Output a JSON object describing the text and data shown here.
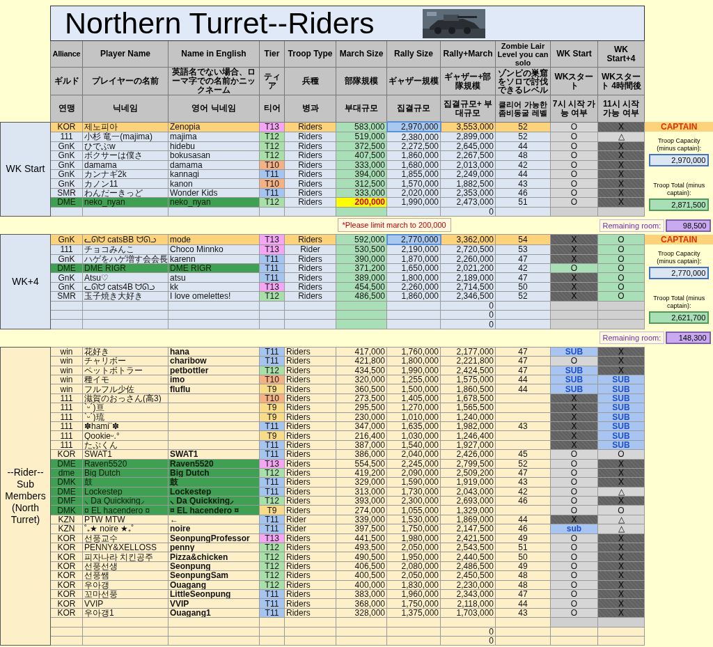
{
  "title": "Northern Turret--Riders",
  "header_rows": [
    [
      "Alliance",
      "Player Name",
      "Name in English",
      "Tier",
      "Troop Type",
      "March Size",
      "Rally Size",
      "Rally+March",
      "Zombie Lair Level you can solo",
      "WK Start",
      "WK Start+4"
    ],
    [
      "ギルド",
      "プレイヤーの名前",
      "英語名でない場合、ローマ字での名前かニックネーム",
      "ティア",
      "兵種",
      "部隊規模",
      "ギャザー規模",
      "ギャザー+部隊規模",
      "ゾンビの巣窟をソロで討伐できるレベル",
      "WKスタート",
      "WKスタート 4時間後"
    ],
    [
      "연맹",
      "닉네임",
      "영어 닉네임",
      "티어",
      "병과",
      "부대규모",
      "집결규모",
      "집결규모+ 부대규모",
      "클리어 가능한 좀비동굴 레벨",
      "7시 시작 가능 여부",
      "11시 시작 가능 여부"
    ]
  ],
  "sections": [
    {
      "label": "WK Start",
      "kind": "wave",
      "note": "*Please limit march to 200,000",
      "side": {
        "badge": "CAPTAIN",
        "capacity_label": "Troop Capacity (minus captain):",
        "capacity": "2,970,000",
        "total_label": "Troop Total (minus captain):",
        "total": "2,871,500",
        "remaining_label": "Remaining room:",
        "remaining": "98,500"
      },
      "rows": [
        {
          "kind": "captain",
          "alliance": "KOR",
          "player": "제노피아",
          "english": "Zenopia",
          "tier": {
            "text": "T13",
            "color": "#f4a6f4"
          },
          "troop": "Riders",
          "march": "583,000",
          "over_limit": false,
          "rally": "2,970,000",
          "total": "3,553,000",
          "lair": "52",
          "wk": {
            "text": "O",
            "kind": "yes"
          },
          "wk4": {
            "text": "X",
            "kind": "no"
          }
        },
        {
          "kind": "normal",
          "alliance": "111",
          "player": "小杉 竜一(majima)",
          "english": "majima",
          "tier": {
            "text": "T12",
            "color": "#a9dfa9"
          },
          "troop": "Riders",
          "march": "519,000",
          "over_limit": false,
          "rally": "2,380,000",
          "total": "2,899,000",
          "lair": "52",
          "wk": {
            "text": "O",
            "kind": "yes"
          },
          "wk4": {
            "text": "△",
            "kind": "maybe"
          }
        },
        {
          "kind": "normal",
          "alliance": "GnK",
          "player": "ひでぶw",
          "english": "hidebu",
          "tier": {
            "text": "T12",
            "color": "#a9dfa9"
          },
          "troop": "Riders",
          "march": "372,500",
          "over_limit": false,
          "rally": "2,272,500",
          "total": "2,645,000",
          "lair": "44",
          "wk": {
            "text": "O",
            "kind": "yes"
          },
          "wk4": {
            "text": "X",
            "kind": "no"
          }
        },
        {
          "kind": "normal",
          "alliance": "GnK",
          "player": "ボクサーは僕さ",
          "english": "bokusasan",
          "tier": {
            "text": "T12",
            "color": "#a9dfa9"
          },
          "troop": "Riders",
          "march": "407,500",
          "over_limit": false,
          "rally": "1,860,000",
          "total": "2,267,500",
          "lair": "48",
          "wk": {
            "text": "O",
            "kind": "yes"
          },
          "wk4": {
            "text": "X",
            "kind": "no"
          }
        },
        {
          "kind": "normal",
          "alliance": "GnK",
          "player": "damama",
          "english": "damama",
          "tier": {
            "text": "T10",
            "color": "#f4b183"
          },
          "troop": "Riders",
          "march": "333,000",
          "over_limit": false,
          "rally": "1,680,000",
          "total": "2,013,000",
          "lair": "42",
          "wk": {
            "text": "O",
            "kind": "yes"
          },
          "wk4": {
            "text": "X",
            "kind": "no"
          }
        },
        {
          "kind": "normal",
          "alliance": "GnK",
          "player": "カンナギ2k",
          "english": "kannagi",
          "tier": {
            "text": "T11",
            "color": "#a6c4f0"
          },
          "troop": "Riders",
          "march": "394,000",
          "over_limit": false,
          "rally": "1,855,000",
          "total": "2,249,000",
          "lair": "44",
          "wk": {
            "text": "O",
            "kind": "yes"
          },
          "wk4": {
            "text": "X",
            "kind": "no"
          }
        },
        {
          "kind": "normal",
          "alliance": "GnK",
          "player": "カノン11",
          "english": "kanon",
          "tier": {
            "text": "T10",
            "color": "#f4b183"
          },
          "troop": "Riders",
          "march": "312,500",
          "over_limit": false,
          "rally": "1,570,000",
          "total": "1,882,500",
          "lair": "43",
          "wk": {
            "text": "O",
            "kind": "yes"
          },
          "wk4": {
            "text": "X",
            "kind": "no"
          }
        },
        {
          "kind": "normal",
          "alliance": "SMR",
          "player": "わんだーきっど",
          "english": "Wonder Kids",
          "tier": {
            "text": "T11",
            "color": "#a6c4f0"
          },
          "troop": "Riders",
          "march": "333,000",
          "over_limit": false,
          "rally": "2,020,000",
          "total": "2,353,000",
          "lair": "46",
          "wk": {
            "text": "O",
            "kind": "yes"
          },
          "wk4": {
            "text": "X",
            "kind": "no"
          }
        },
        {
          "kind": "ally",
          "alliance": "DME",
          "player": "neko_nyan",
          "english": "neko_nyan",
          "tier": {
            "text": "T12",
            "color": "#a9dfa9"
          },
          "troop": "Riders",
          "march": "200,000",
          "over_limit": true,
          "rally": "1,990,000",
          "total": "2,473,000",
          "lair": "51",
          "wk": {
            "text": "O",
            "kind": "yes"
          },
          "wk4": {
            "text": "X",
            "kind": "no"
          }
        },
        {
          "kind": "normal",
          "total": "0",
          "over_limit": false,
          "wk": {
            "kind": "blank"
          },
          "wk4": {
            "kind": "blank"
          }
        }
      ]
    },
    {
      "label": "WK+4",
      "kind": "wave",
      "side": {
        "badge": "CAPTAIN",
        "capacity_label": "Troop Capacity (minus captain):",
        "capacity": "2,770,000",
        "total_label": "Troop Total (minus captain):",
        "total": "2,621,700",
        "remaining_label": "Remaining room:",
        "remaining": "148,300"
      },
      "rows": [
        {
          "kind": "captain",
          "alliance": "GnK",
          "player": "ᓚᘏᗢ catsBB ᗢᘏᓗ",
          "english": "mode",
          "tier": {
            "text": "T13",
            "color": "#f4a6f4"
          },
          "troop": "Riders",
          "march": "592,000",
          "over_limit": false,
          "rally": "2,770,000",
          "total": "3,362,000",
          "lair": "54",
          "wk": {
            "text": "X",
            "kind": "no"
          },
          "wk4": {
            "text": "O",
            "kind": "go"
          }
        },
        {
          "kind": "normal",
          "alliance": "111",
          "player": "チョコみんこ",
          "english": "Choco Minnko",
          "tier": {
            "text": "T13",
            "color": "#f4a6f4"
          },
          "troop": "Rider",
          "march": "530,500",
          "over_limit": false,
          "rally": "2,190,000",
          "total": "2,720,500",
          "lair": "53",
          "wk": {
            "text": "X",
            "kind": "no"
          },
          "wk4": {
            "text": "O",
            "kind": "go"
          }
        },
        {
          "kind": "normal",
          "alliance": "GnK",
          "player": "ハゲをハゲ増す会会長",
          "english": "karenn",
          "tier": {
            "text": "T11",
            "color": "#a6c4f0"
          },
          "troop": "Riders",
          "march": "390,000",
          "over_limit": false,
          "rally": "1,870,000",
          "total": "2,260,000",
          "lair": "47",
          "wk": {
            "text": "X",
            "kind": "no"
          },
          "wk4": {
            "text": "O",
            "kind": "go"
          }
        },
        {
          "kind": "ally",
          "alliance": "DME",
          "player": "DME RIGR",
          "english": "DME RIGR",
          "tier": {
            "text": "T11",
            "color": "#a6c4f0"
          },
          "troop": "Riders",
          "march": "371,200",
          "over_limit": false,
          "rally": "1,650,000",
          "total": "2,021,200",
          "lair": "42",
          "wk": {
            "text": "O",
            "kind": "go"
          },
          "wk4": {
            "text": "O",
            "kind": "go"
          }
        },
        {
          "kind": "normal",
          "alliance": "GnK",
          "player": "Atsu♡",
          "english": "atsu",
          "tier": {
            "text": "T11",
            "color": "#a6c4f0"
          },
          "troop": "Riders",
          "march": "389,000",
          "over_limit": false,
          "rally": "1,800,000",
          "total": "2,189,000",
          "lair": "47",
          "wk": {
            "text": "X",
            "kind": "no"
          },
          "wk4": {
            "text": "O",
            "kind": "go"
          }
        },
        {
          "kind": "normal",
          "alliance": "GnK",
          "player": "ᓚᘏᗢ cats4B ᗢᘏᓗ",
          "english": "kk",
          "tier": {
            "text": "T13",
            "color": "#f4a6f4"
          },
          "troop": "Riders",
          "march": "454,500",
          "over_limit": false,
          "rally": "2,260,000",
          "total": "2,714,500",
          "lair": "50",
          "wk": {
            "text": "X",
            "kind": "no"
          },
          "wk4": {
            "text": "O",
            "kind": "go"
          }
        },
        {
          "kind": "normal",
          "alliance": "SMR",
          "player": "玉子焼き大好き",
          "english": "I love omelettes!",
          "tier": {
            "text": "T12",
            "color": "#a9dfa9"
          },
          "troop": "Riders",
          "march": "486,500",
          "over_limit": false,
          "rally": "1,860,000",
          "total": "2,346,500",
          "lair": "52",
          "wk": {
            "text": "X",
            "kind": "no"
          },
          "wk4": {
            "text": "O",
            "kind": "go"
          }
        },
        {
          "kind": "normal",
          "total": "0",
          "over_limit": false,
          "wk": {
            "kind": "blank"
          },
          "wk4": {
            "kind": "blank"
          }
        },
        {
          "kind": "normal",
          "total": "0",
          "over_limit": false,
          "wk": {
            "kind": "blank"
          },
          "wk4": {
            "kind": "blank"
          }
        },
        {
          "kind": "normal",
          "total": "0",
          "over_limit": false,
          "wk": {
            "kind": "blank"
          },
          "wk4": {
            "kind": "blank"
          }
        }
      ]
    },
    {
      "label": "--Rider-- Sub Members (North Turret)",
      "kind": "reserve",
      "rows": [
        {
          "kind": "normal",
          "alliance": "win",
          "player": "花好き",
          "english": "hana",
          "tier": {
            "text": "T11",
            "color": "#a6c4f0"
          },
          "troop": "Riders",
          "march": "417,000",
          "over_limit": false,
          "rally": "1,760,000",
          "total": "2,177,000",
          "lair": "47",
          "wk": {
            "text": "SUB",
            "kind": "sub"
          },
          "wk4": {
            "text": "X",
            "kind": "no"
          }
        },
        {
          "kind": "normal",
          "alliance": "win",
          "player": "チャリボー",
          "english": "charibow",
          "tier": {
            "text": "T11",
            "color": "#a6c4f0"
          },
          "troop": "Riders",
          "march": "421,800",
          "over_limit": false,
          "rally": "1,800,000",
          "total": "2,221,800",
          "lair": "47",
          "wk": {
            "text": "O",
            "kind": "yes"
          },
          "wk4": {
            "text": "X",
            "kind": "no"
          }
        },
        {
          "kind": "normal",
          "alliance": "win",
          "player": "ペットボトラー",
          "english": "petbottler",
          "tier": {
            "text": "T12",
            "color": "#a9dfa9"
          },
          "troop": "Riders",
          "march": "434,500",
          "over_limit": false,
          "rally": "1,990,000",
          "total": "2,424,500",
          "lair": "47",
          "wk": {
            "text": "SUB",
            "kind": "sub"
          },
          "wk4": {
            "text": "X",
            "kind": "no"
          }
        },
        {
          "kind": "normal",
          "alliance": "win",
          "player": "種イモ",
          "english": "imo",
          "tier": {
            "text": "T10",
            "color": "#f4b183"
          },
          "troop": "Riders",
          "march": "320,000",
          "over_limit": false,
          "rally": "1,255,000",
          "total": "1,575,000",
          "lair": "44",
          "wk": {
            "text": "SUB",
            "kind": "sub"
          },
          "wk4": {
            "text": "SUB",
            "kind": "sub"
          }
        },
        {
          "kind": "normal",
          "alliance": "win",
          "player": "フルフル少佐",
          "english": "fluflu",
          "tier": {
            "text": "T9",
            "color": "#f9dc8a"
          },
          "troop": "Riders",
          "march": "360,500",
          "over_limit": false,
          "rally": "1,500,000",
          "total": "1,860,500",
          "lair": "44",
          "wk": {
            "text": "SUB",
            "kind": "sub"
          },
          "wk4": {
            "text": "SUB",
            "kind": "sub"
          }
        },
        {
          "kind": "normal",
          "alliance": "111",
          "player": "滋賀のおっさん(高3)",
          "tier": {
            "text": "T10",
            "color": "#f4b183"
          },
          "troop": "Riders",
          "march": "273,500",
          "over_limit": false,
          "rally": "1,405,000",
          "total": "1,678,500",
          "wk": {
            "text": "X",
            "kind": "no"
          },
          "wk4": {
            "text": "SUB",
            "kind": "sub"
          }
        },
        {
          "kind": "normal",
          "alliance": "111",
          "player": "`ᵕ´)亘",
          "tier": {
            "text": "T9",
            "color": "#f9dc8a"
          },
          "troop": "Riders",
          "march": "295,500",
          "over_limit": false,
          "rally": "1,270,000",
          "total": "1,565,500",
          "wk": {
            "text": "X",
            "kind": "no"
          },
          "wk4": {
            "text": "SUB",
            "kind": "sub"
          }
        },
        {
          "kind": "normal",
          "alliance": "111",
          "player": "`ᵕ´)琉",
          "tier": {
            "text": "T9",
            "color": "#f9dc8a"
          },
          "troop": "Riders",
          "march": "230,000",
          "over_limit": false,
          "rally": "1,010,000",
          "total": "1,240,000",
          "wk": {
            "text": "X",
            "kind": "no"
          },
          "wk4": {
            "text": "SUB",
            "kind": "sub"
          }
        },
        {
          "kind": "normal",
          "alliance": "111",
          "player": "✽hami¨✽",
          "tier": {
            "text": "T11",
            "color": "#a6c4f0"
          },
          "troop": "Riders",
          "march": "347,000",
          "over_limit": false,
          "rally": "1,635,000",
          "total": "1,982,000",
          "lair": "43",
          "wk": {
            "text": "X",
            "kind": "no"
          },
          "wk4": {
            "text": "SUB",
            "kind": "sub"
          }
        },
        {
          "kind": "normal",
          "alliance": "111",
          "player": "Qookieᵕ.°",
          "tier": {
            "text": "T9",
            "color": "#f9dc8a"
          },
          "troop": "Riders",
          "march": "216,400",
          "over_limit": false,
          "rally": "1,030,000",
          "total": "1,246,400",
          "wk": {
            "text": "X",
            "kind": "no"
          },
          "wk4": {
            "text": "SUB",
            "kind": "sub"
          }
        },
        {
          "kind": "normal",
          "alliance": "111",
          "player": "たぷくん",
          "tier": {
            "text": "T11",
            "color": "#a6c4f0"
          },
          "troop": "Riders",
          "march": "387,000",
          "over_limit": false,
          "rally": "1,540,000",
          "total": "1,927,000",
          "wk": {
            "text": "X",
            "kind": "no"
          },
          "wk4": {
            "text": "SUB",
            "kind": "sub"
          }
        },
        {
          "kind": "normal",
          "alliance": "KOR",
          "player": "SWAT1",
          "english": "SWAT1",
          "tier": {
            "text": "T11",
            "color": "#a6c4f0"
          },
          "troop": "Riders",
          "march": "386,000",
          "over_limit": false,
          "rally": "2,040,000",
          "total": "2,426,000",
          "lair": "45",
          "wk": {
            "text": "O",
            "kind": "yes"
          },
          "wk4": {
            "text": "O",
            "kind": "yes"
          }
        },
        {
          "kind": "ally",
          "alliance": "DME",
          "player": "Raven5520",
          "english": "Raven5520",
          "tier": {
            "text": "T13",
            "color": "#f4a6f4"
          },
          "troop": "Riders",
          "march": "554,500",
          "over_limit": false,
          "rally": "2,245,000",
          "total": "2,799,500",
          "lair": "52",
          "wk": {
            "text": "O",
            "kind": "yes"
          },
          "wk4": {
            "text": "X",
            "kind": "no"
          }
        },
        {
          "kind": "ally",
          "alliance": "dme",
          "player": "Big Dutch",
          "english": "Big Dutch",
          "tier": {
            "text": "T12",
            "color": "#a9dfa9"
          },
          "troop": "Riders",
          "march": "419,200",
          "over_limit": false,
          "rally": "2,090,000",
          "total": "2,509,200",
          "lair": "47",
          "wk": {
            "text": "O",
            "kind": "yes"
          },
          "wk4": {
            "text": "X",
            "kind": "no"
          }
        },
        {
          "kind": "ally",
          "alliance": "DMK",
          "player": "鼓",
          "english": "鼓",
          "tier": {
            "text": "T11",
            "color": "#a6c4f0"
          },
          "troop": "Riders",
          "march": "329,000",
          "over_limit": false,
          "rally": "1,590,000",
          "total": "1,919,000",
          "lair": "43",
          "wk": {
            "text": "O",
            "kind": "yes"
          },
          "wk4": {
            "text": "X",
            "kind": "no"
          }
        },
        {
          "kind": "ally",
          "alliance": "DME",
          "player": "Lockestep",
          "english": "Lockestep",
          "tier": {
            "text": "T11",
            "color": "#a6c4f0"
          },
          "troop": "Riders",
          "march": "313,000",
          "over_limit": false,
          "rally": "1,730,000",
          "total": "2,043,000",
          "lair": "42",
          "wk": {
            "text": "O",
            "kind": "yes"
          },
          "wk4": {
            "text": "△",
            "kind": "maybe"
          }
        },
        {
          "kind": "ally",
          "alliance": "DMF",
          "player": "⸜ Da Quickᴋing⸝",
          "english": "⸜ Da Quickᴋing⸝",
          "tier": {
            "text": "T12",
            "color": "#a9dfa9"
          },
          "troop": "Riders",
          "march": "393,000",
          "over_limit": false,
          "rally": "2,300,000",
          "total": "2,693,000",
          "lair": "46",
          "wk": {
            "text": "O",
            "kind": "yes"
          },
          "wk4": {
            "text": "X",
            "kind": "no"
          }
        },
        {
          "kind": "ally",
          "alliance": "DMK",
          "player": "¤ EL hacendero ¤",
          "english": "¤ EL hacendero ¤",
          "tier": {
            "text": "T9",
            "color": "#f9dc8a"
          },
          "troop": "Riders",
          "march": "274,000",
          "over_limit": false,
          "rally": "1,055,000",
          "total": "1,329,000",
          "wk": {
            "text": "O",
            "kind": "yes"
          },
          "wk4": {
            "text": "O",
            "kind": "yes"
          }
        },
        {
          "kind": "normal",
          "alliance": "KZN",
          "player": "PTW MTW",
          "english": "←",
          "tier": {
            "text": "T11",
            "color": "#a6c4f0"
          },
          "troop": "Rider",
          "march": "339,000",
          "over_limit": false,
          "rally": "1,530,000",
          "total": "1,869,000",
          "lair": "44",
          "wk": {
            "text": "X",
            "kind": "no"
          },
          "wk4": {
            "text": "△",
            "kind": "maybe"
          }
        },
        {
          "kind": "normal",
          "alliance": "KZN",
          "player": "˚₊★ noire ★₊˚",
          "english": "noire",
          "tier": {
            "text": "T11",
            "color": "#a6c4f0"
          },
          "troop": "Rider",
          "march": "397,500",
          "over_limit": false,
          "rally": "1,750,000",
          "total": "2,147,500",
          "lair": "46",
          "wk": {
            "text": "sub",
            "kind": "sub"
          },
          "wk4": {
            "text": "△",
            "kind": "maybe"
          }
        },
        {
          "kind": "normal",
          "alliance": "KOR",
          "player": "선풍교수",
          "english": "SeonpungProfessor",
          "tier": {
            "text": "T13",
            "color": "#f4a6f4"
          },
          "troop": "Riders",
          "march": "441,500",
          "over_limit": false,
          "rally": "1,980,000",
          "total": "2,421,500",
          "lair": "49",
          "wk": {
            "text": "O",
            "kind": "yes"
          },
          "wk4": {
            "text": "X",
            "kind": "no"
          }
        },
        {
          "kind": "normal",
          "alliance": "KOR",
          "player": "PENNY&XELLOSS",
          "english": "penny",
          "tier": {
            "text": "T12",
            "color": "#a9dfa9"
          },
          "troop": "Riders",
          "march": "493,500",
          "over_limit": false,
          "rally": "2,050,000",
          "total": "2,543,500",
          "lair": "51",
          "wk": {
            "text": "O",
            "kind": "yes"
          },
          "wk4": {
            "text": "X",
            "kind": "no"
          }
        },
        {
          "kind": "normal",
          "alliance": "KOR",
          "player": "피자나라 치킨공주",
          "english": "Pizza&chicken",
          "tier": {
            "text": "T12",
            "color": "#a9dfa9"
          },
          "troop": "Riders",
          "march": "490,500",
          "over_limit": false,
          "rally": "1,950,000",
          "total": "2,440,500",
          "lair": "50",
          "wk": {
            "text": "O",
            "kind": "yes"
          },
          "wk4": {
            "text": "X",
            "kind": "no"
          }
        },
        {
          "kind": "normal",
          "alliance": "KOR",
          "player": "선풍선생",
          "english": "Seonpung",
          "tier": {
            "text": "T12",
            "color": "#a9dfa9"
          },
          "troop": "Riders",
          "march": "406,500",
          "over_limit": false,
          "rally": "2,080,000",
          "total": "2,486,500",
          "lair": "49",
          "wk": {
            "text": "O",
            "kind": "yes"
          },
          "wk4": {
            "text": "X",
            "kind": "no"
          }
        },
        {
          "kind": "normal",
          "alliance": "KOR",
          "player": "선풍쌤",
          "english": "SeonpungSam",
          "tier": {
            "text": "T12",
            "color": "#a9dfa9"
          },
          "troop": "Riders",
          "march": "400,500",
          "over_limit": false,
          "rally": "2,050,000",
          "total": "2,450,500",
          "lair": "48",
          "wk": {
            "text": "O",
            "kind": "yes"
          },
          "wk4": {
            "text": "X",
            "kind": "no"
          }
        },
        {
          "kind": "normal",
          "alliance": "KOR",
          "player": "우아갱",
          "english": "Ouagang",
          "tier": {
            "text": "T12",
            "color": "#a9dfa9"
          },
          "troop": "Riders",
          "march": "400,000",
          "over_limit": false,
          "rally": "1,830,000",
          "total": "2,230,000",
          "lair": "48",
          "wk": {
            "text": "O",
            "kind": "yes"
          },
          "wk4": {
            "text": "X",
            "kind": "no"
          }
        },
        {
          "kind": "normal",
          "alliance": "KOR",
          "player": "꼬마선풍",
          "english": "LittleSeonpung",
          "tier": {
            "text": "T11",
            "color": "#a6c4f0"
          },
          "troop": "Riders",
          "march": "383,000",
          "over_limit": false,
          "rally": "1,960,000",
          "total": "2,343,000",
          "lair": "47",
          "wk": {
            "text": "O",
            "kind": "yes"
          },
          "wk4": {
            "text": "X",
            "kind": "no"
          }
        },
        {
          "kind": "normal",
          "alliance": "KOR",
          "player": "VVIP",
          "english": "VVIP",
          "tier": {
            "text": "T11",
            "color": "#a6c4f0"
          },
          "troop": "Riders",
          "march": "368,000",
          "over_limit": false,
          "rally": "1,750,000",
          "total": "2,118,000",
          "lair": "44",
          "wk": {
            "text": "O",
            "kind": "yes"
          },
          "wk4": {
            "text": "X",
            "kind": "no"
          }
        },
        {
          "kind": "normal",
          "alliance": "KOR",
          "player": "우아갱1",
          "english": "Ouagang1",
          "tier": {
            "text": "T11",
            "color": "#a6c4f0"
          },
          "troop": "Riders",
          "march": "328,000",
          "over_limit": false,
          "rally": "1,375,000",
          "total": "1,703,000",
          "lair": "43",
          "wk": {
            "text": "O",
            "kind": "yes"
          },
          "wk4": {
            "text": "X",
            "kind": "no"
          }
        },
        {
          "kind": "normal",
          "over_limit": false,
          "wk": {
            "kind": "blank"
          },
          "wk4": {
            "kind": "blank"
          }
        },
        {
          "kind": "normal",
          "total": "0",
          "over_limit": false
        },
        {
          "kind": "normal",
          "total": "0",
          "over_limit": false
        }
      ]
    }
  ]
}
